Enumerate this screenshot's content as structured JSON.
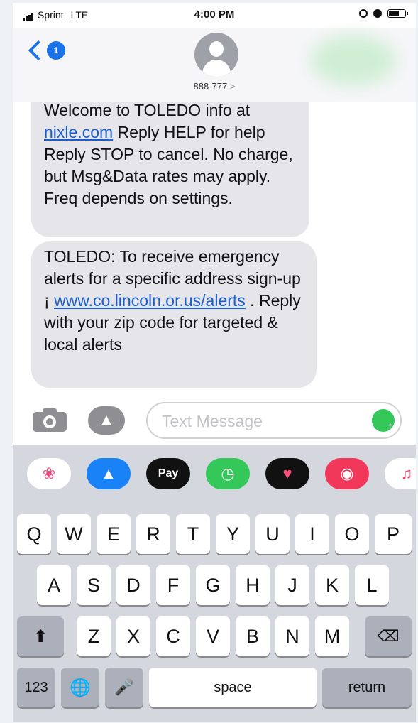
{
  "status_bar": {
    "carrier": "Sprint",
    "network": "LTE",
    "time": "4:00 PM"
  },
  "header": {
    "back_count": "1",
    "contact": "888-777",
    "contact_arrow": ">"
  },
  "messages": [
    {
      "line_top": "Welcome to TOLEDO info at",
      "link": "nixle.com",
      "text_after_link": " Reply HELP for help Reply STOP to cancel. No charge, but Msg&Data rates may apply. Freq depends on settings."
    },
    {
      "text_before_link": "TOLEDO: To receive emergency alerts for a specific address sign-up ¡ ",
      "link": "www.co.lincoln.or.us/alerts",
      "text_after_link": " . Reply with your zip code for targeted & local alerts"
    }
  ],
  "input": {
    "placeholder": "Text Message",
    "send_icon": "arrow-up-icon"
  },
  "app_strip": [
    {
      "name": "photos-icon",
      "color": "#ffffff"
    },
    {
      "name": "app-store-icon",
      "color": "#1a82f7"
    },
    {
      "name": "apple-pay-icon",
      "label": "Pay",
      "color": "#111111"
    },
    {
      "name": "clock-icon",
      "color": "#34c759"
    },
    {
      "name": "heart-icon",
      "color": "#111111"
    },
    {
      "name": "search-globe-icon",
      "color": "#f2385a"
    },
    {
      "name": "music-icon",
      "color": "#ffffff"
    }
  ],
  "keyboard": {
    "row1": [
      "Q",
      "W",
      "E",
      "R",
      "T",
      "Y",
      "U",
      "I",
      "O",
      "P"
    ],
    "row2": [
      "A",
      "S",
      "D",
      "F",
      "G",
      "H",
      "J",
      "K",
      "L"
    ],
    "row3": [
      "Z",
      "X",
      "C",
      "V",
      "B",
      "N",
      "M"
    ],
    "numbers_label": "123",
    "space_label": "space",
    "return_label": "return"
  }
}
